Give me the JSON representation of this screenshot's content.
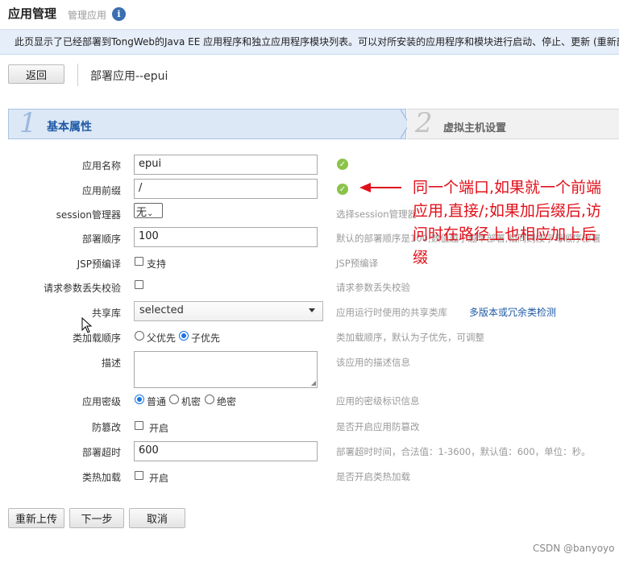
{
  "header": {
    "title": "应用管理",
    "subtitle": "管理应用",
    "info_icon": "i"
  },
  "notice": "此页显示了已经部署到TongWeb的Java EE 应用程序和独立应用程序模块列表。可以对所安装的应用程序和模块进行启动、停止、更新 (重新部",
  "toolbar": {
    "back_label": "返回",
    "breadcrumb": "部署应用--epui"
  },
  "wizard": {
    "steps": [
      {
        "number": "1",
        "label": "基本属性"
      },
      {
        "number": "2",
        "label": "虚拟主机设置"
      }
    ]
  },
  "form": {
    "app_name": {
      "label": "应用名称",
      "value": "epui"
    },
    "app_prefix": {
      "label": "应用前缀",
      "value": "/"
    },
    "session_manager": {
      "label": "session管理器",
      "value": "无",
      "hint": "选择session管理器"
    },
    "deploy_order": {
      "label": "部署顺序",
      "value": "100",
      "hint": "默认的部署顺序是100,数值越小越早部署,相同则按字母顺序部署"
    },
    "jsp_precompile": {
      "label": "JSP预编译",
      "option": "支持",
      "hint": "JSP预编译"
    },
    "param_loss_check": {
      "label": "请求参数丢失校验",
      "hint": "请求参数丢失校验"
    },
    "shared_lib": {
      "label": "共享库",
      "value": "selected",
      "hint": "应用运行时使用的共享类库",
      "link": "多版本或冗余类检测"
    },
    "classload_order": {
      "label": "类加载顺序",
      "options": [
        "父优先",
        "子优先"
      ],
      "selected": "子优先",
      "hint": "类加载顺序，默认为子优先，可调整"
    },
    "description": {
      "label": "描述",
      "hint": "该应用的描述信息"
    },
    "security_level": {
      "label": "应用密级",
      "options": [
        "普通",
        "机密",
        "绝密"
      ],
      "selected": "普通",
      "hint": "应用的密级标识信息"
    },
    "tamper_proof": {
      "label": "防篡改",
      "option": "开启",
      "hint": "是否开启应用防篡改"
    },
    "deploy_timeout": {
      "label": "部署超时",
      "value": "600",
      "hint": "部署超时时间，合法值：1-3600，默认值：600，单位：秒。"
    },
    "hot_load": {
      "label": "类热加载",
      "option": "开启",
      "hint": "是否开启类热加载"
    }
  },
  "buttons": {
    "reupload": "重新上传",
    "next": "下一步",
    "cancel": "取消"
  },
  "annotation": "同一个端口,如果就一个前端应用,直接/;如果加后缀后,访问时在路径上也相应加上后缀",
  "watermark": "CSDN @banyoyo",
  "colors": {
    "accent": "#1f5aa6",
    "annotation": "#e0101a",
    "ok": "#8bc34a"
  }
}
